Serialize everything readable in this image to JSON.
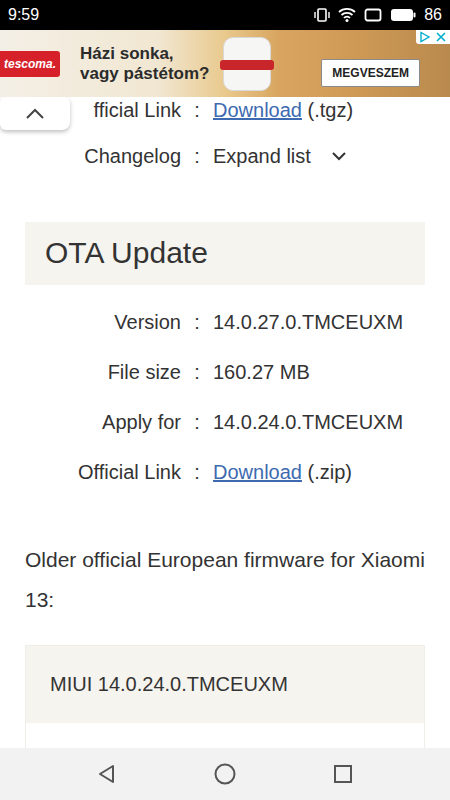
{
  "status_bar": {
    "time": "9:59",
    "battery": "86"
  },
  "ad": {
    "brand": "tescoma.",
    "headline": [
      "Házi sonka,",
      "vagy pástétom?"
    ],
    "button": "MEGVESZEM"
  },
  "top_rows": [
    {
      "label": "fficial Link",
      "separator": ":",
      "value": "Download",
      "suffix": "(.tgz)",
      "kind": "link"
    },
    {
      "label": "Changelog",
      "separator": ":",
      "value": "Expand list",
      "kind": "toggle",
      "expanded": false
    }
  ],
  "ota": {
    "title": "OTA Update",
    "rows": [
      {
        "label": "Version",
        "separator": ":",
        "value": "14.0.27.0.TMCEUXM",
        "kind": "text"
      },
      {
        "label": "File size",
        "separator": ":",
        "value": "160.27 MB",
        "kind": "text"
      },
      {
        "label": "Apply for",
        "separator": ":",
        "value": "14.0.24.0.TMCEUXM",
        "kind": "text"
      },
      {
        "label": "Official Link",
        "separator": ":",
        "value": "Download",
        "suffix": "(.zip)",
        "kind": "link"
      }
    ]
  },
  "older": {
    "heading": "Older official European firmware for Xiaomi 13:",
    "items": [
      "MIUI 14.0.24.0.TMCEUXM"
    ]
  }
}
